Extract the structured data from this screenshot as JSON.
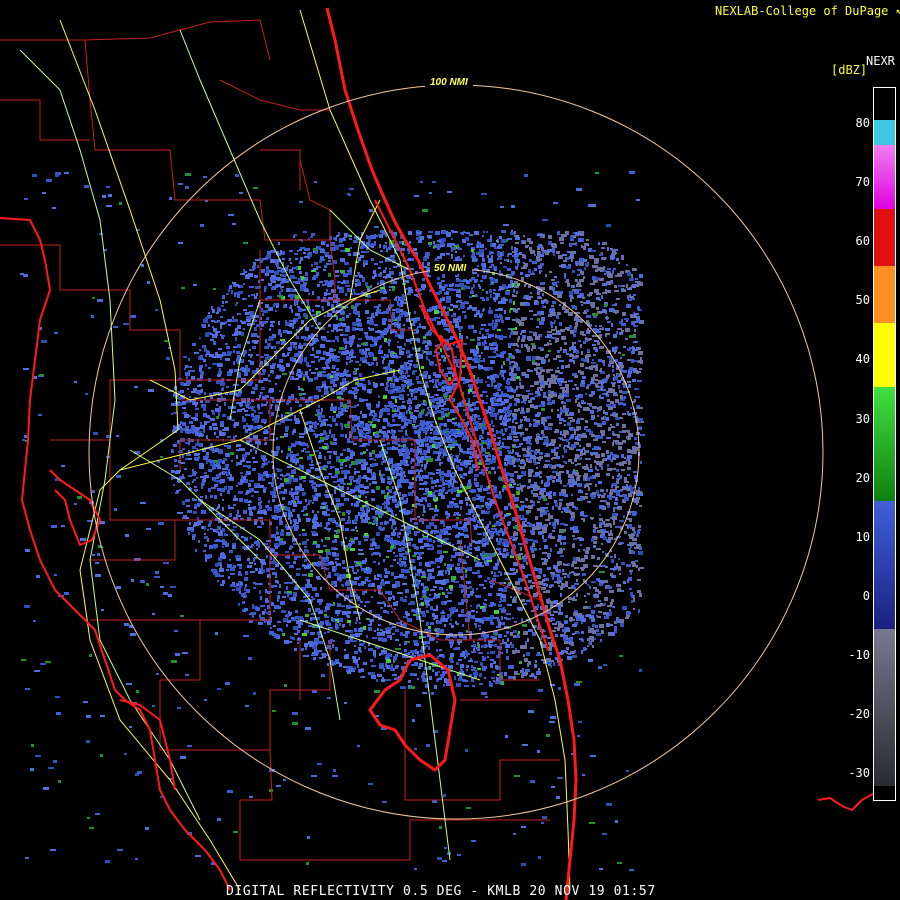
{
  "header": {
    "credit": "NEXLAB-College of DuPage ↖",
    "product_code": "NEXR",
    "units": "[dBZ]"
  },
  "footer": {
    "product": "DIGITAL REFLECTIVITY 0.5 DEG - KMLB 20 NOV 19 01:57"
  },
  "legend": {
    "ticks": [
      "80",
      "70",
      "60",
      "50",
      "40",
      "30",
      "20",
      "10",
      "0",
      "-10",
      "-20",
      "-30"
    ],
    "colors": {
      "ice": "#3ec8e0",
      "pink": "#f080f0",
      "magenta": "#e000e0",
      "red": "#e01010",
      "orange": "#ff9020",
      "yellow": "#ffff00",
      "green_light": "#40e040",
      "green_dark": "#108010",
      "blue": "#4060d8",
      "navy": "#1a2080",
      "gray": "#787890",
      "gray_dark": "#2a2a30"
    }
  },
  "range_rings": [
    {
      "label": "100 NMI"
    },
    {
      "label": "50 NMI"
    }
  ]
}
